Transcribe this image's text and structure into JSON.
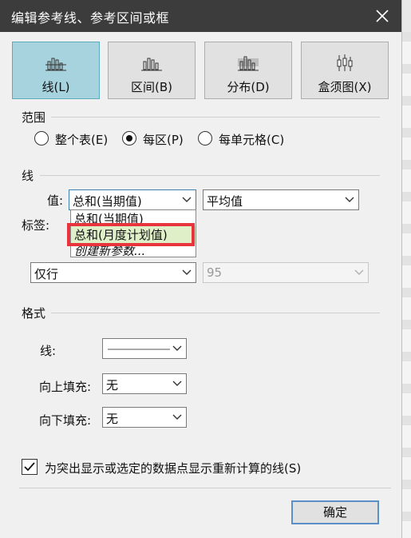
{
  "window": {
    "title": "编辑参考线、参考区间或框"
  },
  "tabs": [
    {
      "label": "线(L)",
      "icon": "line-bars-icon",
      "active": true
    },
    {
      "label": "区间(B)",
      "icon": "band-bars-icon",
      "active": false
    },
    {
      "label": "分布(D)",
      "icon": "distribution-bars-icon",
      "active": false
    },
    {
      "label": "盒须图(X)",
      "icon": "boxplot-icon",
      "active": false
    }
  ],
  "scope": {
    "label": "范围",
    "options": [
      {
        "label": "整个表(E)",
        "selected": false
      },
      {
        "label": "每区(P)",
        "selected": true
      },
      {
        "label": "每单元格(C)",
        "selected": false
      }
    ]
  },
  "line_section": {
    "label": "线",
    "value_label": "值:",
    "value_selected": "总和(当期值)",
    "aggregation_selected": "平均值",
    "label_label": "标签:",
    "dropdown_options": [
      "总和(当期值)",
      "总和(月度计划值)",
      "创建新参数..."
    ],
    "tooltip_selected": "仅行",
    "tooltip_value": "95"
  },
  "format": {
    "label": "格式",
    "line_label": "线:",
    "fill_above_label": "向上填充:",
    "fill_above_value": "无",
    "fill_below_label": "向下填充:",
    "fill_below_value": "无"
  },
  "recalc_checkbox": {
    "label": "为突出显示或选定的数据点显示重新计算的线(S)",
    "checked": true
  },
  "buttons": {
    "ok": "确定"
  },
  "colors": {
    "active_tab": "#a7d3de",
    "highlight": "#e8343c",
    "dropdown_hover": "#dff0c8"
  }
}
